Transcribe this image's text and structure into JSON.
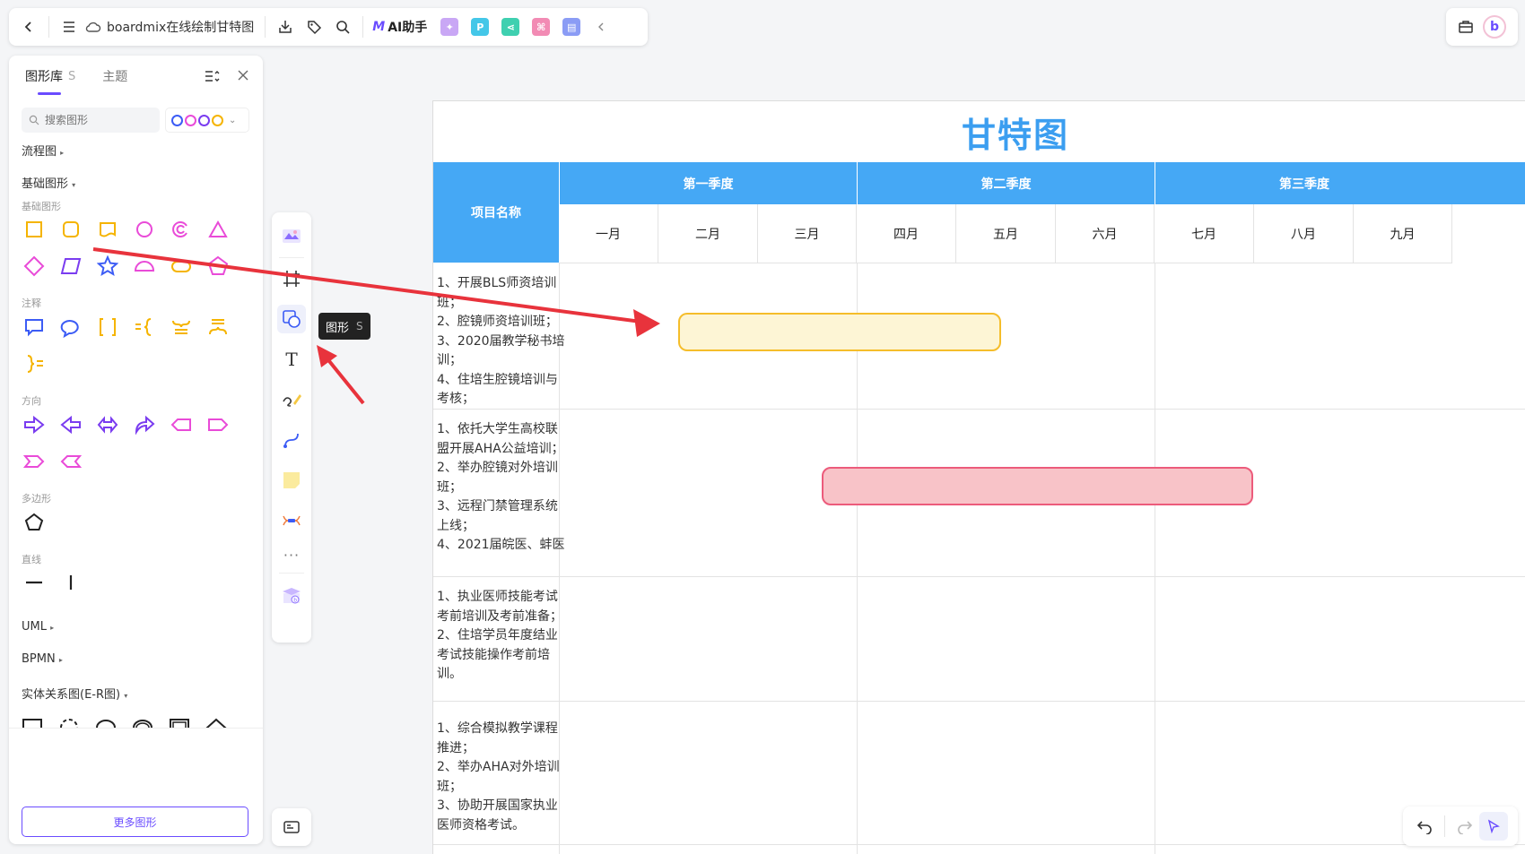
{
  "topbar": {
    "title": "boardmix在线绘制甘特图",
    "ai_label": "AI助手",
    "plugin_p": "P"
  },
  "panel": {
    "tab_shapes": "图形库",
    "tab_shapes_hotkey": "S",
    "tab_theme": "主题",
    "search_placeholder": "搜索图形",
    "cat_flowchart": "流程图",
    "cat_basic": "基础图形",
    "sub_basic": "基础图形",
    "sub_annotation": "注释",
    "sub_direction": "方向",
    "sub_polygon": "多边形",
    "sub_line": "直线",
    "cat_uml": "UML",
    "cat_bpmn": "BPMN",
    "cat_er": "实体关系图(E-R图)",
    "more_button": "更多图形"
  },
  "tooltip": {
    "label": "图形",
    "hotkey": "S"
  },
  "colors": {
    "accent": "#6a4cff",
    "header_blue": "#45a8f5",
    "title_blue": "#3b9ef0",
    "arrow": "#e8333c",
    "bar1_fill": "#fdf5d5",
    "bar1_border": "#f5bd2a",
    "bar2_fill": "#f8c3c8",
    "bar2_border": "#ec5b7b"
  },
  "gantt": {
    "title": "甘特图",
    "project_header": "项目名称",
    "quarters": [
      "第一季度",
      "第二季度",
      "第三季度"
    ],
    "months": [
      "一月",
      "二月",
      "三月",
      "四月",
      "五月",
      "六月",
      "七月",
      "八月",
      "九月"
    ],
    "tasks": [
      "1、开展BLS师资培训班；\n2、腔镜师资培训班；\n3、2020届教学秘书培训；\n4、住培生腔镜培训与考核；",
      "1、依托大学生高校联盟开展AHA公益培训；\n2、举办腔镜对外培训班；\n3、远程门禁管理系统上线；\n4、2021届皖医、蚌医",
      "1、执业医师技能考试考前培训及考前准备；\n2、住培学员年度结业考试技能操作考前培训。",
      "1、综合模拟教学课程推进；\n2、举办AHA对外培训班；\n3、协助开展国家执业医师资格考试。"
    ]
  }
}
